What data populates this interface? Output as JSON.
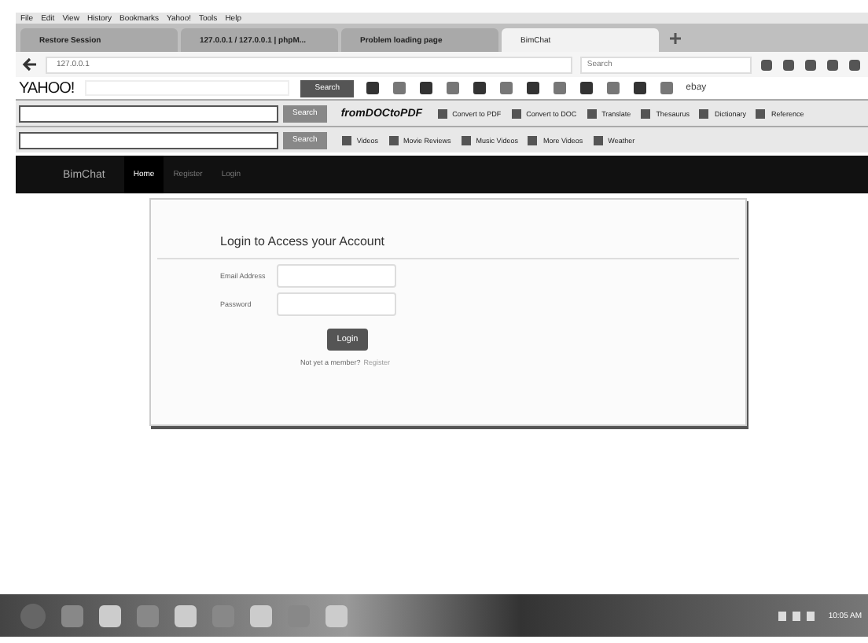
{
  "menu_bar": [
    "File",
    "Edit",
    "View",
    "History",
    "Bookmarks",
    "Yahoo!",
    "Tools",
    "Help"
  ],
  "tabs": [
    {
      "label": "Restore Session",
      "selected": false
    },
    {
      "label": "127.0.0.1 / 127.0.0.1 | phpM...",
      "selected": false
    },
    {
      "label": "Problem loading page",
      "selected": false
    },
    {
      "label": "BimChat",
      "selected": true
    }
  ],
  "address_bar": {
    "url": "127.0.0.1",
    "search_placeholder": "Search"
  },
  "yahoo_toolbar": {
    "logo": "YAHOO!",
    "search_button": "Search",
    "ebay": "ebay"
  },
  "pdf_toolbar": {
    "search_button": "Search",
    "logo": "fromDOCtoPDF",
    "links": [
      "Convert to PDF",
      "Convert to DOC",
      "Translate",
      "Thesaurus",
      "Dictionary",
      "Reference"
    ]
  },
  "video_toolbar": {
    "search_button": "Search",
    "links": [
      "Videos",
      "Movie Reviews",
      "Music Videos",
      "More Videos",
      "Weather"
    ]
  },
  "navbar": {
    "brand": "BimChat",
    "items": [
      {
        "label": "Home",
        "selected": true
      },
      {
        "label": "Register",
        "selected": false
      },
      {
        "label": "Login",
        "selected": false
      }
    ]
  },
  "login_card": {
    "title": "Login to Access your Account",
    "email_label": "Email Address",
    "password_label": "Password",
    "button": "Login",
    "prompt": "Not yet a member?",
    "register_link": "Register"
  },
  "taskbar": {
    "time": "10:05 AM"
  }
}
